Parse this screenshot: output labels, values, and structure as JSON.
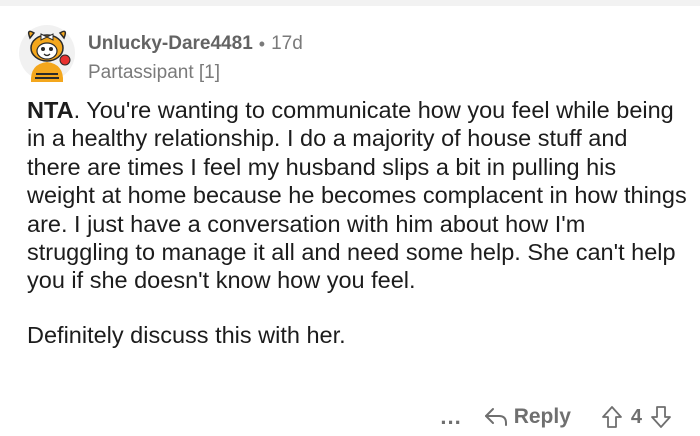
{
  "comment": {
    "author": "Unlucky-Dare4481",
    "separator": "•",
    "age": "17d",
    "flair": "Partassipant [1]",
    "paragraphs": [
      {
        "lead_bold": "NTA",
        "text": ". You're wanting to communicate how you feel while being in a healthy relationship. I do a majority of house stuff and there are times I feel my husband slips a bit in pulling his weight at home because he becomes complacent in how things are. I just have a conversation with him about how I'm struggling to manage it all and need some help. She can't help you if she doesn't know how you feel."
      },
      {
        "text": "Definitely discuss this with her."
      }
    ]
  },
  "actions": {
    "more_label": "...",
    "reply_label": "Reply",
    "score": "4"
  },
  "icons": {
    "avatar": "snoo-avatar-dog-costume",
    "more": "more-dots-icon",
    "reply": "reply-arrow-icon",
    "upvote": "upvote-arrow-icon",
    "downvote": "downvote-arrow-icon"
  },
  "colors": {
    "text": "#1c1c1c",
    "meta": "#7a7a7a",
    "username": "#636363",
    "action": "#6f6f6f",
    "avatar_orange": "#f4a71d",
    "avatar_red": "#e8312f"
  }
}
